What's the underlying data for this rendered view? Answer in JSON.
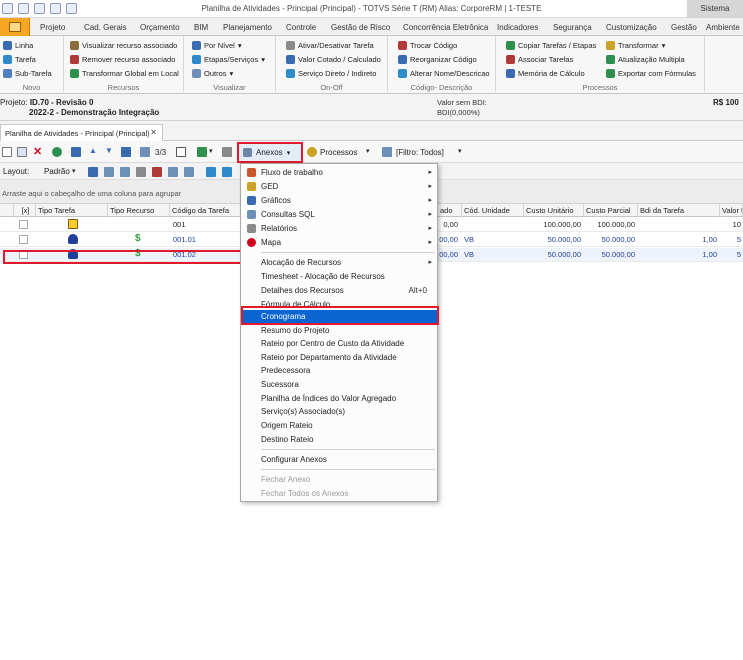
{
  "window": {
    "title": "Planilha de Atividades - Principal (Principal) - TOTVS Série T  (RM) Alias: CorporeRM | 1-TESTE",
    "sistema_label": "Sistema"
  },
  "ribbon_tabs": [
    "Projeto",
    "Cad. Gerais",
    "Orçamento",
    "BIM",
    "Planejamento",
    "Controle",
    "Gestão de Risco",
    "Concorrência Eletrônica",
    "Indicadores",
    "Segurança",
    "Customização",
    "Gestão",
    "Ambiente"
  ],
  "ribbon": {
    "novo": {
      "label": "Novo",
      "items": [
        "Linha",
        "Tarefa",
        "Sub-Tarefa"
      ]
    },
    "recursos": {
      "label": "Recursos",
      "items": [
        "Visualizar recurso associado",
        "Remover recurso associado",
        "Transformar Global em Local"
      ]
    },
    "visualizar": {
      "label": "Visualizar",
      "items": [
        "Por Nível",
        "Etapas/Serviços",
        "Outros"
      ]
    },
    "onoff": {
      "label": "On-Off",
      "items": [
        "Ativar/Desativar Tarefa",
        "Valor Cotado / Calculado",
        "Serviço Direto / Indireto"
      ]
    },
    "codigo": {
      "label": "Código- Descrição",
      "items": [
        "Trocar Código",
        "Reorganizar Código",
        "Alterar Nome/Descricao"
      ]
    },
    "processos": {
      "label": "Processos",
      "items": [
        "Copiar Tarefas / Etapas",
        "Associar Tarefas",
        "Memória de Cálculo",
        "Transformar",
        "Atualização Multipla",
        "Exportar com Fórmulas"
      ]
    }
  },
  "project": {
    "prefix": "Projeto:",
    "id": "ID.70 - Revisão 0",
    "name": "2022-2 - Demonstração Integração",
    "bdi_label": "Valor sem BDI:",
    "bdi_value": "BDI(0,000%)",
    "currency": "R$ 100"
  },
  "doc_tab": {
    "label": "Planilha de Atividades - Principal (Principal)",
    "close": "✕"
  },
  "toolbar": {
    "counter": "3/3",
    "anexos": "Anexos",
    "processos": "Processos",
    "filtro": "[Filtro: Todos]",
    "layout_label": "Layout:",
    "layout_value": "Padrão"
  },
  "grid": {
    "group_hint": "Arraste aqui o cabeçalho de uma coluna para agrupar",
    "columns": [
      "[x]",
      "Tipo Tarefa",
      "Tipo Recurso",
      "Código da Tarefa",
      "ado",
      "Cód. Unidade",
      "Custo Unitário",
      "Custo Parcial",
      "Bdi da Tarefa",
      "Valor U"
    ],
    "rows": [
      {
        "codigo": "001",
        "ado": "0,00",
        "unidade": "",
        "custo_unit": "100.000,00",
        "custo_parcial": "100.000,00",
        "bdi": "",
        "valor": "10"
      },
      {
        "codigo": "001.01",
        "ado": "00,00",
        "unidade": "VB",
        "custo_unit": "50.000,00",
        "custo_parcial": "50.000,00",
        "bdi": "1,00",
        "valor": "5"
      },
      {
        "codigo": "001.02",
        "ado": "00,00",
        "unidade": "VB",
        "custo_unit": "50.000,00",
        "custo_parcial": "50.000,00",
        "bdi": "1,00",
        "valor": "5"
      }
    ]
  },
  "anexos_menu": {
    "items": [
      {
        "label": "Fluxo de trabalho",
        "submenu": true
      },
      {
        "label": "GED",
        "submenu": true
      },
      {
        "label": "Gráficos",
        "submenu": true
      },
      {
        "label": "Consultas SQL",
        "submenu": true
      },
      {
        "label": "Relatórios",
        "submenu": true
      },
      {
        "label": "Mapa",
        "submenu": true
      },
      {
        "label": "Alocação de Recursos",
        "submenu": true
      },
      {
        "label": "Timesheet - Alocação de Recursos"
      },
      {
        "label": "Detalhes dos Recursos",
        "shortcut": "Alt+0"
      },
      {
        "label": "Fórmula de Cálculo"
      },
      {
        "label": "Cronograma",
        "highlighted": true
      },
      {
        "label": "Resumo do Projeto"
      },
      {
        "label": "Rateio por Centro de Custo da Atividade"
      },
      {
        "label": "Rateio por Departamento da Atividade"
      },
      {
        "label": "Predecessora"
      },
      {
        "label": "Sucessora"
      },
      {
        "label": "Planilha de Índices do Valor Agregado"
      },
      {
        "label": "Serviço(s) Associado(s)"
      },
      {
        "label": "Origem Rateio"
      },
      {
        "label": "Destino Rateio"
      },
      {
        "label": "Configurar Anexos"
      },
      {
        "label": "Fechar Anexo",
        "disabled": true
      },
      {
        "label": "Fechar Todos os Anexos",
        "disabled": true
      }
    ]
  }
}
